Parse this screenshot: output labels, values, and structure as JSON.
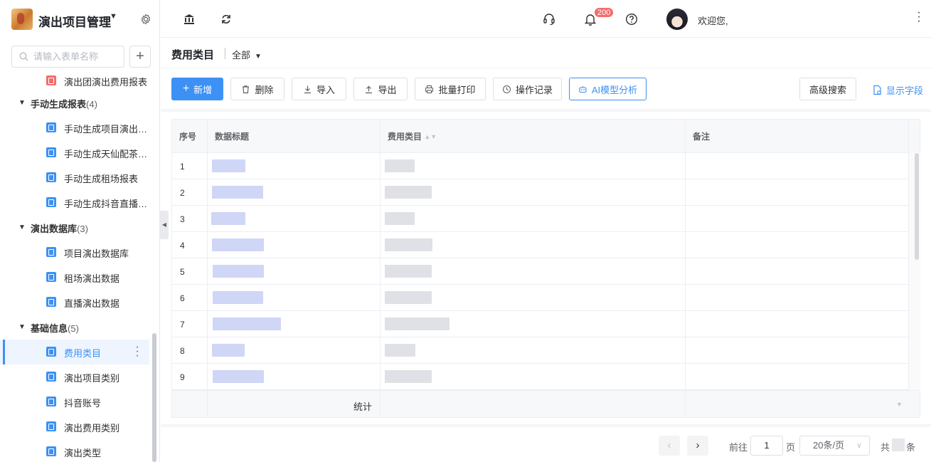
{
  "app": {
    "title": "演出项目管理"
  },
  "sidebar": {
    "search_placeholder": "请输入表单名称",
    "add_label": "+",
    "truncated_item": "演出团演出费用报表",
    "groups": [
      {
        "name": "手动生成报表",
        "count": "(4)",
        "items": [
          "手动生成项目演出报表",
          "手动生成天仙配茶报表",
          "手动生成租场报表",
          "手动生成抖音直播报表"
        ]
      },
      {
        "name": "演出数据库",
        "count": "(3)",
        "items": [
          "项目演出数据库",
          "租场演出数据",
          "直播演出数据"
        ]
      },
      {
        "name": "基础信息",
        "count": "(5)",
        "items": [
          "费用类目",
          "演出项目类别",
          "抖音账号",
          "演出费用类别",
          "演出类型"
        ]
      }
    ],
    "active_item": "费用类目"
  },
  "topbar": {
    "notification_count": "200",
    "welcome": "欢迎您,"
  },
  "page": {
    "title": "费用类目",
    "filter": "全部"
  },
  "toolbar": {
    "add": "新增",
    "delete": "删除",
    "import": "导入",
    "export": "导出",
    "batch_print": "批量打印",
    "op_log": "操作记录",
    "ai_analysis": "AI模型分析",
    "advanced_search": "高级搜索",
    "show_fields": "显示字段"
  },
  "table": {
    "columns": [
      "序号",
      "数据标题",
      "费用类目",
      "备注"
    ],
    "rows": [
      {
        "no": "1"
      },
      {
        "no": "2"
      },
      {
        "no": "3"
      },
      {
        "no": "4"
      },
      {
        "no": "5"
      },
      {
        "no": "6"
      },
      {
        "no": "7"
      },
      {
        "no": "8"
      },
      {
        "no": "9"
      }
    ],
    "footer_label": "统计"
  },
  "pagination": {
    "goto_label": "前往",
    "page": "1",
    "page_unit": "页",
    "page_size": "20条/页",
    "total_prefix": "共",
    "total_suffix": "条"
  },
  "colors": {
    "accent": "#3d91f5",
    "badge": "#f56c6c"
  }
}
